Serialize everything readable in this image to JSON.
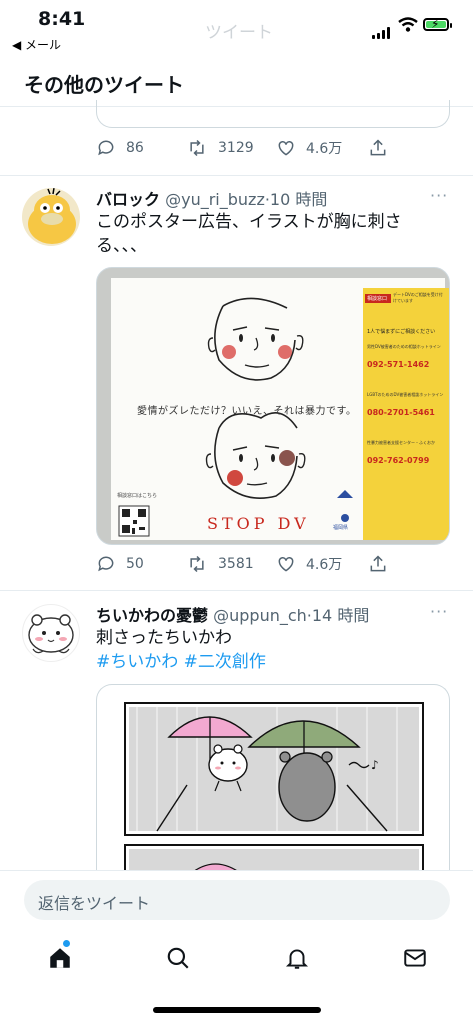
{
  "status_bar": {
    "time": "8:41",
    "back_app": "◀ メール",
    "ghost_title": "ツイート"
  },
  "header": {
    "title": "その他のツイート"
  },
  "prev_tweet": {
    "replies": "86",
    "retweets": "3129",
    "likes": "4.6万"
  },
  "tweets": [
    {
      "name": "バロック",
      "handle": "@yu_ri_buzz",
      "time": "·10 時間",
      "text_lines": [
        "このポスター広告、イラストが胸に刺さ",
        "る、、、"
      ],
      "replies": "50",
      "retweets": "3581",
      "likes": "4.6万",
      "poster": {
        "caption": "愛情がズレただけ？いいえ、それは暴力です。",
        "slogan": "STOP DV",
        "qr_caption": "相談窓口はこちら",
        "side_header": "相談窓口",
        "side_intro": "デートDVのご相談を受け付けています",
        "side_title": "1人で悩まずにご相談ください",
        "org1": "男性DV被害者のための相談ホットライン",
        "tel1": "092-571-1462",
        "org2": "LGBTのためのDV被害者相談ホットライン",
        "tel2": "080-2701-5461",
        "org3": "性暴力被害者支援センター・ふくおか",
        "tel3": "092-762-0799",
        "city": "福岡県"
      }
    },
    {
      "name": "ちいかわの憂鬱",
      "handle": "@uppun_ch",
      "time": "·14 時間",
      "text": "刺さったちいかわ",
      "hashtags": "#ちいかわ #二次創作"
    }
  ],
  "reply_bar": {
    "placeholder": "返信をツイート"
  },
  "tab_bar": [
    "home-icon",
    "search-icon",
    "bell-icon",
    "mail-icon"
  ],
  "colors": {
    "accent": "#1d9bf0",
    "poster_yellow": "#f4d23b",
    "poster_red": "#c8281e",
    "text_secondary": "#536471"
  }
}
